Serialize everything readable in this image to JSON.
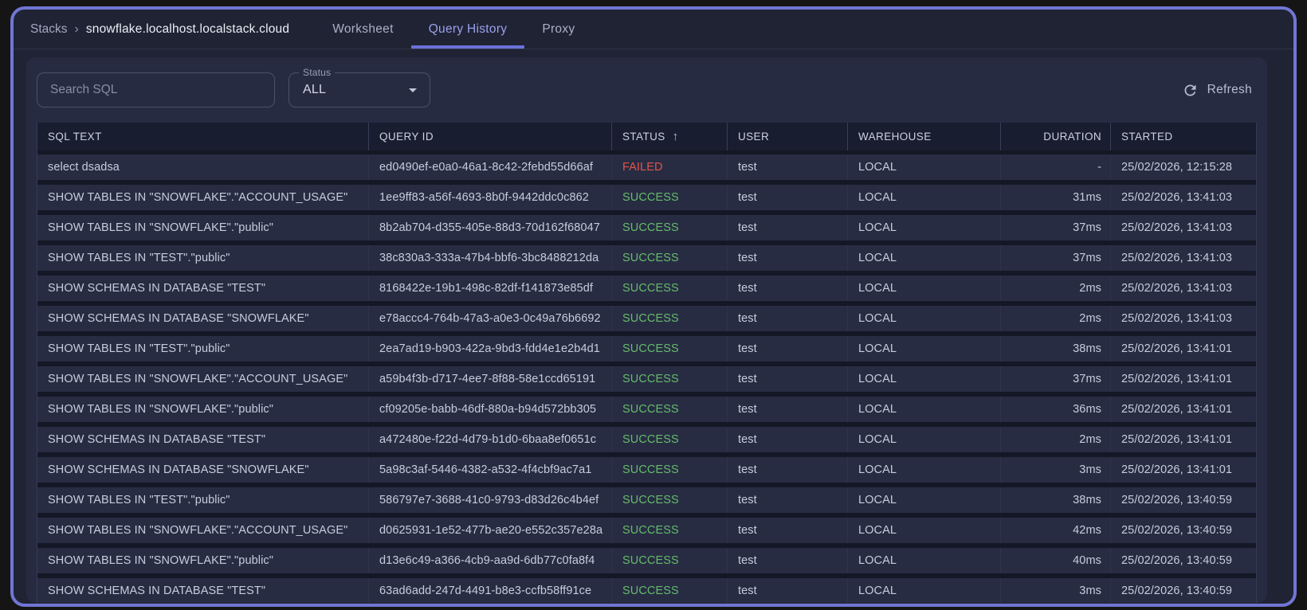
{
  "breadcrumb": {
    "section": "Stacks",
    "separator": "›",
    "current": "snowflake.localhost.localstack.cloud"
  },
  "tabs": [
    {
      "label": "Worksheet",
      "active": false
    },
    {
      "label": "Query History",
      "active": true
    },
    {
      "label": "Proxy",
      "active": false
    }
  ],
  "toolbar": {
    "search_placeholder": "Search SQL",
    "status_label": "Status",
    "status_value": "ALL",
    "refresh_label": "Refresh"
  },
  "table": {
    "columns": [
      "SQL TEXT",
      "QUERY ID",
      "STATUS",
      "USER",
      "WAREHOUSE",
      "DURATION",
      "STARTED"
    ],
    "sort": {
      "column": "STATUS",
      "direction": "asc",
      "icon": "↑"
    },
    "rows": [
      {
        "sql": "select dsadsa",
        "query_id": "ed0490ef-e0a0-46a1-8c42-2febd55d66af",
        "status": "FAILED",
        "user": "test",
        "warehouse": "LOCAL",
        "duration": "-",
        "started": "25/02/2026, 12:15:28"
      },
      {
        "sql": "SHOW TABLES IN \"SNOWFLAKE\".\"ACCOUNT_USAGE\"",
        "query_id": "1ee9ff83-a56f-4693-8b0f-9442ddc0c862",
        "status": "SUCCESS",
        "user": "test",
        "warehouse": "LOCAL",
        "duration": "31ms",
        "started": "25/02/2026, 13:41:03"
      },
      {
        "sql": "SHOW TABLES IN \"SNOWFLAKE\".\"public\"",
        "query_id": "8b2ab704-d355-405e-88d3-70d162f68047",
        "status": "SUCCESS",
        "user": "test",
        "warehouse": "LOCAL",
        "duration": "37ms",
        "started": "25/02/2026, 13:41:03"
      },
      {
        "sql": "SHOW TABLES IN \"TEST\".\"public\"",
        "query_id": "38c830a3-333a-47b4-bbf6-3bc8488212da",
        "status": "SUCCESS",
        "user": "test",
        "warehouse": "LOCAL",
        "duration": "37ms",
        "started": "25/02/2026, 13:41:03"
      },
      {
        "sql": "SHOW SCHEMAS IN DATABASE \"TEST\"",
        "query_id": "8168422e-19b1-498c-82df-f141873e85df",
        "status": "SUCCESS",
        "user": "test",
        "warehouse": "LOCAL",
        "duration": "2ms",
        "started": "25/02/2026, 13:41:03"
      },
      {
        "sql": "SHOW SCHEMAS IN DATABASE \"SNOWFLAKE\"",
        "query_id": "e78accc4-764b-47a3-a0e3-0c49a76b6692",
        "status": "SUCCESS",
        "user": "test",
        "warehouse": "LOCAL",
        "duration": "2ms",
        "started": "25/02/2026, 13:41:03"
      },
      {
        "sql": "SHOW TABLES IN \"TEST\".\"public\"",
        "query_id": "2ea7ad19-b903-422a-9bd3-fdd4e1e2b4d1",
        "status": "SUCCESS",
        "user": "test",
        "warehouse": "LOCAL",
        "duration": "38ms",
        "started": "25/02/2026, 13:41:01"
      },
      {
        "sql": "SHOW TABLES IN \"SNOWFLAKE\".\"ACCOUNT_USAGE\"",
        "query_id": "a59b4f3b-d717-4ee7-8f88-58e1ccd65191",
        "status": "SUCCESS",
        "user": "test",
        "warehouse": "LOCAL",
        "duration": "37ms",
        "started": "25/02/2026, 13:41:01"
      },
      {
        "sql": "SHOW TABLES IN \"SNOWFLAKE\".\"public\"",
        "query_id": "cf09205e-babb-46df-880a-b94d572bb305",
        "status": "SUCCESS",
        "user": "test",
        "warehouse": "LOCAL",
        "duration": "36ms",
        "started": "25/02/2026, 13:41:01"
      },
      {
        "sql": "SHOW SCHEMAS IN DATABASE \"TEST\"",
        "query_id": "a472480e-f22d-4d79-b1d0-6baa8ef0651c",
        "status": "SUCCESS",
        "user": "test",
        "warehouse": "LOCAL",
        "duration": "2ms",
        "started": "25/02/2026, 13:41:01"
      },
      {
        "sql": "SHOW SCHEMAS IN DATABASE \"SNOWFLAKE\"",
        "query_id": "5a98c3af-5446-4382-a532-4f4cbf9ac7a1",
        "status": "SUCCESS",
        "user": "test",
        "warehouse": "LOCAL",
        "duration": "3ms",
        "started": "25/02/2026, 13:41:01"
      },
      {
        "sql": "SHOW TABLES IN \"TEST\".\"public\"",
        "query_id": "586797e7-3688-41c0-9793-d83d26c4b4ef",
        "status": "SUCCESS",
        "user": "test",
        "warehouse": "LOCAL",
        "duration": "38ms",
        "started": "25/02/2026, 13:40:59"
      },
      {
        "sql": "SHOW TABLES IN \"SNOWFLAKE\".\"ACCOUNT_USAGE\"",
        "query_id": "d0625931-1e52-477b-ae20-e552c357e28a",
        "status": "SUCCESS",
        "user": "test",
        "warehouse": "LOCAL",
        "duration": "42ms",
        "started": "25/02/2026, 13:40:59"
      },
      {
        "sql": "SHOW TABLES IN \"SNOWFLAKE\".\"public\"",
        "query_id": "d13e6c49-a366-4cb9-aa9d-6db77c0fa8f4",
        "status": "SUCCESS",
        "user": "test",
        "warehouse": "LOCAL",
        "duration": "40ms",
        "started": "25/02/2026, 13:40:59"
      },
      {
        "sql": "SHOW SCHEMAS IN DATABASE \"TEST\"",
        "query_id": "63ad6add-247d-4491-b8e3-ccfb58ff91ce",
        "status": "SUCCESS",
        "user": "test",
        "warehouse": "LOCAL",
        "duration": "3ms",
        "started": "25/02/2026, 13:40:59"
      }
    ]
  },
  "colors": {
    "window_border": "#7176d3",
    "tab_active": "#9ba1ec",
    "tab_indicator": "#6b71d8",
    "success": "#66bb6a",
    "failed": "#e25449",
    "panel_bg": "#262b42",
    "header_bg": "#191d30",
    "row_bg": "#272c43"
  }
}
